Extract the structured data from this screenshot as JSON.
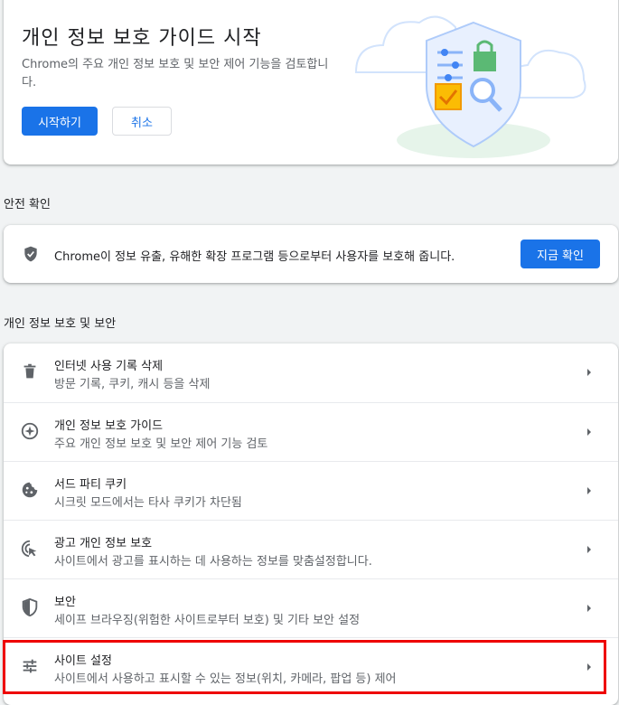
{
  "guide": {
    "title": "개인 정보 보호 가이드 시작",
    "description": "Chrome의 주요 개인 정보 보호 및 보안 제어 기능을 검토합니다.",
    "start_label": "시작하기",
    "cancel_label": "취소"
  },
  "safety_check": {
    "section_title": "안전 확인",
    "description": "Chrome이 정보 유출, 유해한 확장 프로그램 등으로부터 사용자를 보호해 줍니다.",
    "button_label": "지금 확인"
  },
  "privacy": {
    "section_title": "개인 정보 보호 및 보안",
    "items": [
      {
        "icon": "trash-icon",
        "title": "인터넷 사용 기록 삭제",
        "subtitle": "방문 기록, 쿠키, 캐시 등을 삭제"
      },
      {
        "icon": "compass-icon",
        "title": "개인 정보 보호 가이드",
        "subtitle": "주요 개인 정보 보호 및 보안 제어 기능 검토"
      },
      {
        "icon": "cookie-icon",
        "title": "서드 파티 쿠키",
        "subtitle": "시크릿 모드에서는 타사 쿠키가 차단됨"
      },
      {
        "icon": "ad-privacy-icon",
        "title": "광고 개인 정보 보호",
        "subtitle": "사이트에서 광고를 표시하는 데 사용하는 정보를 맞춤설정합니다."
      },
      {
        "icon": "shield-icon",
        "title": "보안",
        "subtitle": "세이프 브라우징(위험한 사이트로부터 보호) 및 기타 보안 설정"
      },
      {
        "icon": "sliders-icon",
        "title": "사이트 설정",
        "subtitle": "사이트에서 사용하고 표시할 수 있는 정보(위치, 카메라, 팝업 등) 제어"
      }
    ]
  },
  "colors": {
    "accent": "#1a73e8",
    "highlight": "#ee0000",
    "background": "#f1f3f4"
  }
}
